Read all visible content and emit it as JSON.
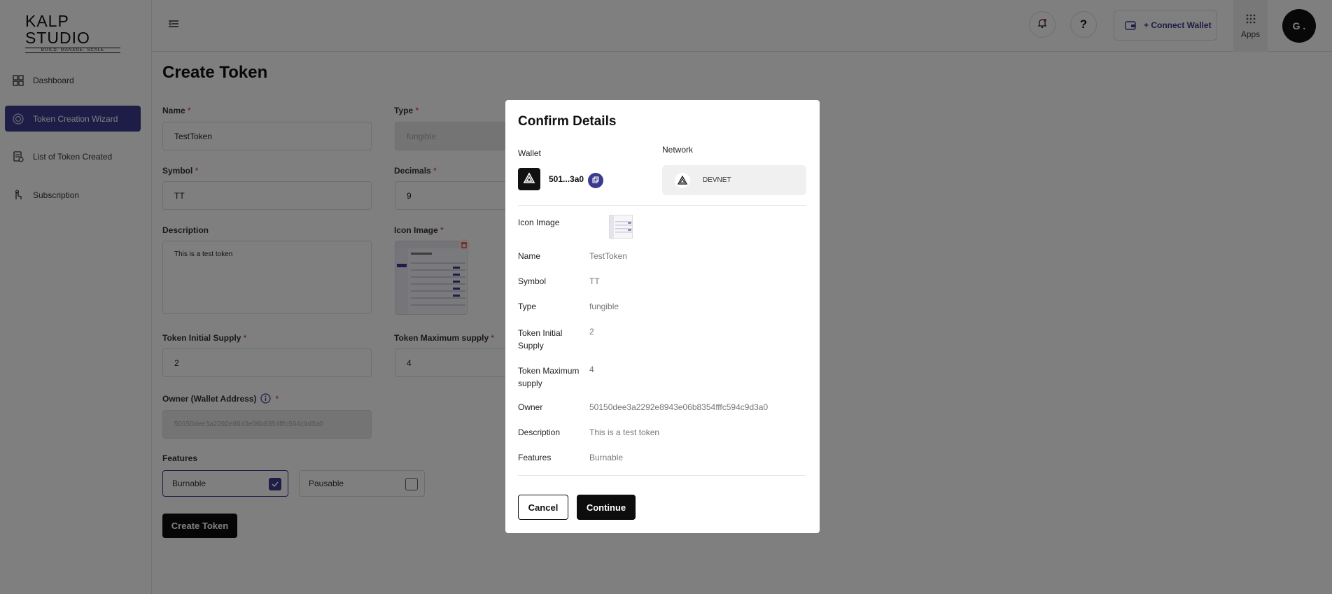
{
  "brand": {
    "logo_text": "KALP STUDIO",
    "logo_tagline": "BUILD. MANAGE. SCALE"
  },
  "sidebar": {
    "items": [
      {
        "label": "Dashboard",
        "icon": "grid-icon"
      },
      {
        "label": "Token Creation Wizard",
        "icon": "target-icon",
        "active": true
      },
      {
        "label": "List of Token Created",
        "icon": "list-icon"
      },
      {
        "label": "Subscription",
        "icon": "hand-icon"
      }
    ]
  },
  "header": {
    "connect_wallet": "+ Connect Wallet",
    "apps_label": "Apps",
    "avatar_initials": "G ."
  },
  "form": {
    "title": "Create Token",
    "name_label": "Name",
    "name_value": "TestToken",
    "type_label": "Type",
    "type_value": "fungible",
    "symbol_label": "Symbol",
    "symbol_value": "TT",
    "decimals_label": "Decimals",
    "decimals_value": "9",
    "description_label": "Description",
    "description_value": "This is a test token",
    "icon_label": "Icon Image",
    "initial_supply_label": "Token Initial Supply",
    "initial_supply_value": "2",
    "max_supply_label": "Token Maximum supply",
    "max_supply_value": "4",
    "owner_label": "Owner (Wallet Address)",
    "owner_value": "50150dee3a2292e8943e06b8354fffc594c9d3a0",
    "features_label": "Features",
    "features": [
      {
        "label": "Burnable",
        "checked": true
      },
      {
        "label": "Pausable",
        "checked": false
      }
    ],
    "submit_label": "Create Token",
    "required_mark": "*"
  },
  "modal": {
    "title": "Confirm Details",
    "wallet_label": "Wallet",
    "wallet_address": "501...3a0",
    "network_label": "Network",
    "network_value": "DEVNET",
    "icon_label": "Icon Image",
    "rows": [
      {
        "label": "Name",
        "value": "TestToken"
      },
      {
        "label": "Symbol",
        "value": "TT"
      },
      {
        "label": "Type",
        "value": "fungible"
      },
      {
        "label": "Token Initial Supply",
        "value": "2"
      },
      {
        "label": "Token Maximum supply",
        "value": "4"
      },
      {
        "label": "Owner",
        "value": "50150dee3a2292e8943e06b8354fffc594c9d3a0"
      },
      {
        "label": "Description",
        "value": "This is a test token"
      },
      {
        "label": "Features",
        "value": "Burnable"
      }
    ],
    "cancel_label": "Cancel",
    "continue_label": "Continue"
  },
  "colors": {
    "accent": "#3b3a8f",
    "primary_button": "#0d0d0d",
    "required": "#c62828"
  }
}
